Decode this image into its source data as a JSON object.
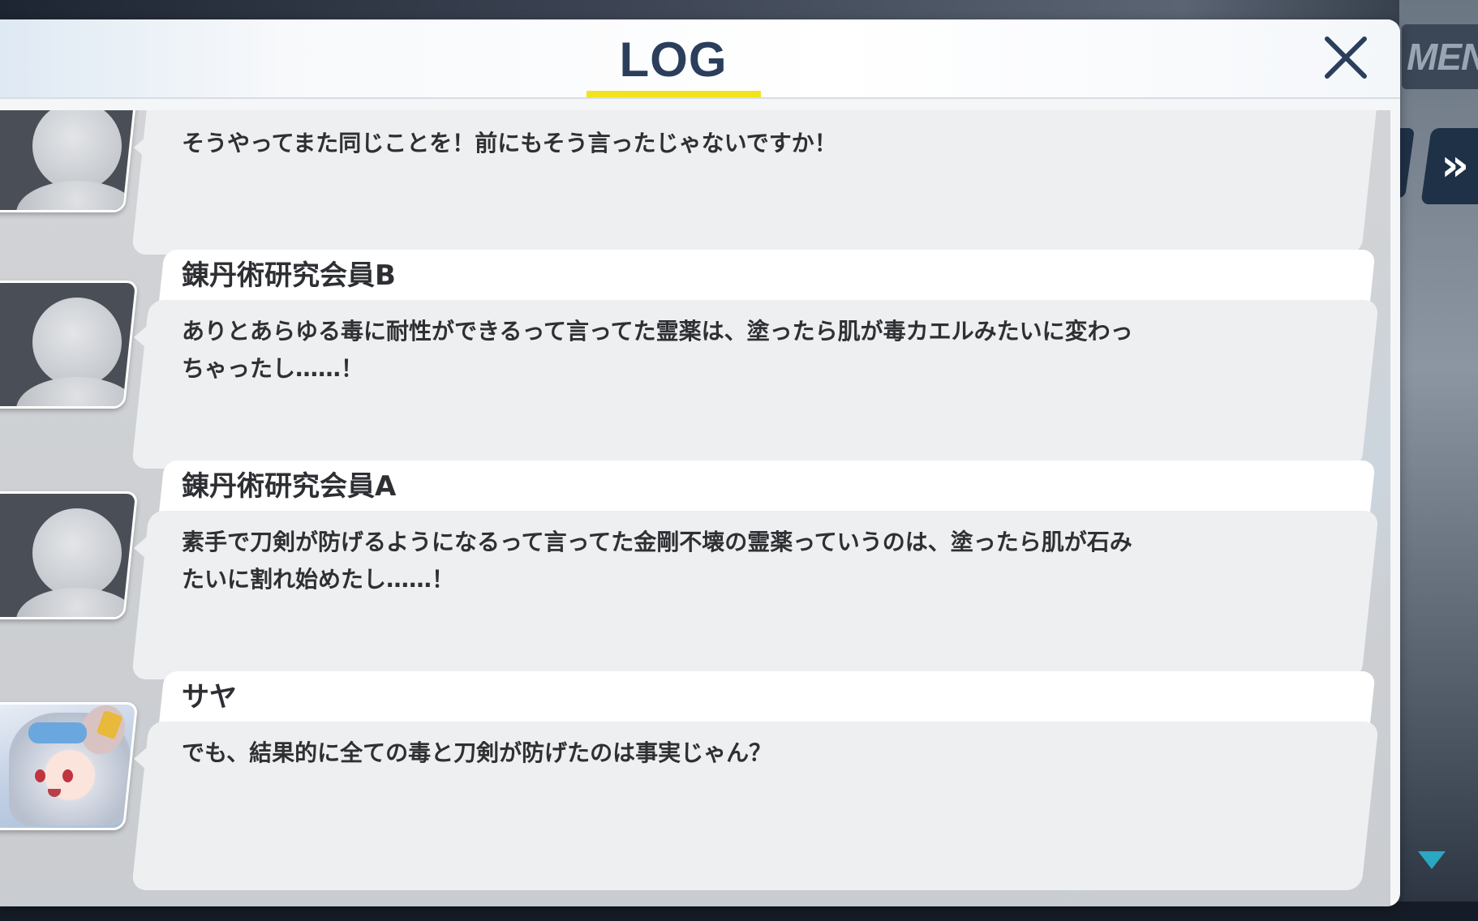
{
  "panel": {
    "title": "LOG",
    "accent_color": "#f1e31d",
    "title_color": "#2b3e5c"
  },
  "controls": {
    "menu_label": "MEN",
    "skip_glyph": "»",
    "close_icon": "close-icon",
    "scroll_icon": "scroll-down-icon"
  },
  "entries": [
    {
      "speaker": "",
      "avatar": "silhouette",
      "text": "そうやってまた同じことを！前にもそう言ったじゃないですか！"
    },
    {
      "speaker": "錬丹術研究会員B",
      "avatar": "silhouette",
      "text": "ありとあらゆる毒に耐性ができるって言ってた霊薬は、塗ったら肌が毒カエルみたいに変わっ\nちゃったし……！"
    },
    {
      "speaker": "錬丹術研究会員A",
      "avatar": "silhouette",
      "text": "素手で刀剣が防げるようになるって言ってた金剛不壊の霊薬っていうのは、塗ったら肌が石み\nたいに割れ始めたし……！"
    },
    {
      "speaker": "サヤ",
      "avatar": "saya-portrait",
      "text": "でも、結果的に全ての毒と刀剣が防げたのは事実じゃん？"
    }
  ]
}
